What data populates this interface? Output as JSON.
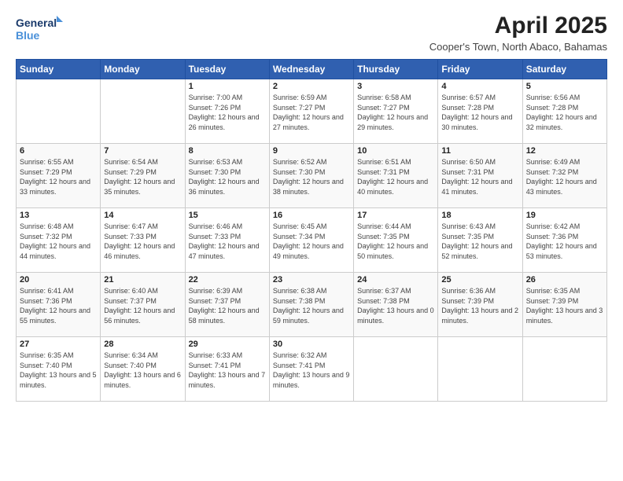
{
  "logo": {
    "line1": "General",
    "line2": "Blue"
  },
  "title": "April 2025",
  "subtitle": "Cooper's Town, North Abaco, Bahamas",
  "headers": [
    "Sunday",
    "Monday",
    "Tuesday",
    "Wednesday",
    "Thursday",
    "Friday",
    "Saturday"
  ],
  "weeks": [
    [
      {
        "day": "",
        "info": ""
      },
      {
        "day": "",
        "info": ""
      },
      {
        "day": "1",
        "info": "Sunrise: 7:00 AM\nSunset: 7:26 PM\nDaylight: 12 hours and 26 minutes."
      },
      {
        "day": "2",
        "info": "Sunrise: 6:59 AM\nSunset: 7:27 PM\nDaylight: 12 hours and 27 minutes."
      },
      {
        "day": "3",
        "info": "Sunrise: 6:58 AM\nSunset: 7:27 PM\nDaylight: 12 hours and 29 minutes."
      },
      {
        "day": "4",
        "info": "Sunrise: 6:57 AM\nSunset: 7:28 PM\nDaylight: 12 hours and 30 minutes."
      },
      {
        "day": "5",
        "info": "Sunrise: 6:56 AM\nSunset: 7:28 PM\nDaylight: 12 hours and 32 minutes."
      }
    ],
    [
      {
        "day": "6",
        "info": "Sunrise: 6:55 AM\nSunset: 7:29 PM\nDaylight: 12 hours and 33 minutes."
      },
      {
        "day": "7",
        "info": "Sunrise: 6:54 AM\nSunset: 7:29 PM\nDaylight: 12 hours and 35 minutes."
      },
      {
        "day": "8",
        "info": "Sunrise: 6:53 AM\nSunset: 7:30 PM\nDaylight: 12 hours and 36 minutes."
      },
      {
        "day": "9",
        "info": "Sunrise: 6:52 AM\nSunset: 7:30 PM\nDaylight: 12 hours and 38 minutes."
      },
      {
        "day": "10",
        "info": "Sunrise: 6:51 AM\nSunset: 7:31 PM\nDaylight: 12 hours and 40 minutes."
      },
      {
        "day": "11",
        "info": "Sunrise: 6:50 AM\nSunset: 7:31 PM\nDaylight: 12 hours and 41 minutes."
      },
      {
        "day": "12",
        "info": "Sunrise: 6:49 AM\nSunset: 7:32 PM\nDaylight: 12 hours and 43 minutes."
      }
    ],
    [
      {
        "day": "13",
        "info": "Sunrise: 6:48 AM\nSunset: 7:32 PM\nDaylight: 12 hours and 44 minutes."
      },
      {
        "day": "14",
        "info": "Sunrise: 6:47 AM\nSunset: 7:33 PM\nDaylight: 12 hours and 46 minutes."
      },
      {
        "day": "15",
        "info": "Sunrise: 6:46 AM\nSunset: 7:33 PM\nDaylight: 12 hours and 47 minutes."
      },
      {
        "day": "16",
        "info": "Sunrise: 6:45 AM\nSunset: 7:34 PM\nDaylight: 12 hours and 49 minutes."
      },
      {
        "day": "17",
        "info": "Sunrise: 6:44 AM\nSunset: 7:35 PM\nDaylight: 12 hours and 50 minutes."
      },
      {
        "day": "18",
        "info": "Sunrise: 6:43 AM\nSunset: 7:35 PM\nDaylight: 12 hours and 52 minutes."
      },
      {
        "day": "19",
        "info": "Sunrise: 6:42 AM\nSunset: 7:36 PM\nDaylight: 12 hours and 53 minutes."
      }
    ],
    [
      {
        "day": "20",
        "info": "Sunrise: 6:41 AM\nSunset: 7:36 PM\nDaylight: 12 hours and 55 minutes."
      },
      {
        "day": "21",
        "info": "Sunrise: 6:40 AM\nSunset: 7:37 PM\nDaylight: 12 hours and 56 minutes."
      },
      {
        "day": "22",
        "info": "Sunrise: 6:39 AM\nSunset: 7:37 PM\nDaylight: 12 hours and 58 minutes."
      },
      {
        "day": "23",
        "info": "Sunrise: 6:38 AM\nSunset: 7:38 PM\nDaylight: 12 hours and 59 minutes."
      },
      {
        "day": "24",
        "info": "Sunrise: 6:37 AM\nSunset: 7:38 PM\nDaylight: 13 hours and 0 minutes."
      },
      {
        "day": "25",
        "info": "Sunrise: 6:36 AM\nSunset: 7:39 PM\nDaylight: 13 hours and 2 minutes."
      },
      {
        "day": "26",
        "info": "Sunrise: 6:35 AM\nSunset: 7:39 PM\nDaylight: 13 hours and 3 minutes."
      }
    ],
    [
      {
        "day": "27",
        "info": "Sunrise: 6:35 AM\nSunset: 7:40 PM\nDaylight: 13 hours and 5 minutes."
      },
      {
        "day": "28",
        "info": "Sunrise: 6:34 AM\nSunset: 7:40 PM\nDaylight: 13 hours and 6 minutes."
      },
      {
        "day": "29",
        "info": "Sunrise: 6:33 AM\nSunset: 7:41 PM\nDaylight: 13 hours and 7 minutes."
      },
      {
        "day": "30",
        "info": "Sunrise: 6:32 AM\nSunset: 7:41 PM\nDaylight: 13 hours and 9 minutes."
      },
      {
        "day": "",
        "info": ""
      },
      {
        "day": "",
        "info": ""
      },
      {
        "day": "",
        "info": ""
      }
    ]
  ]
}
